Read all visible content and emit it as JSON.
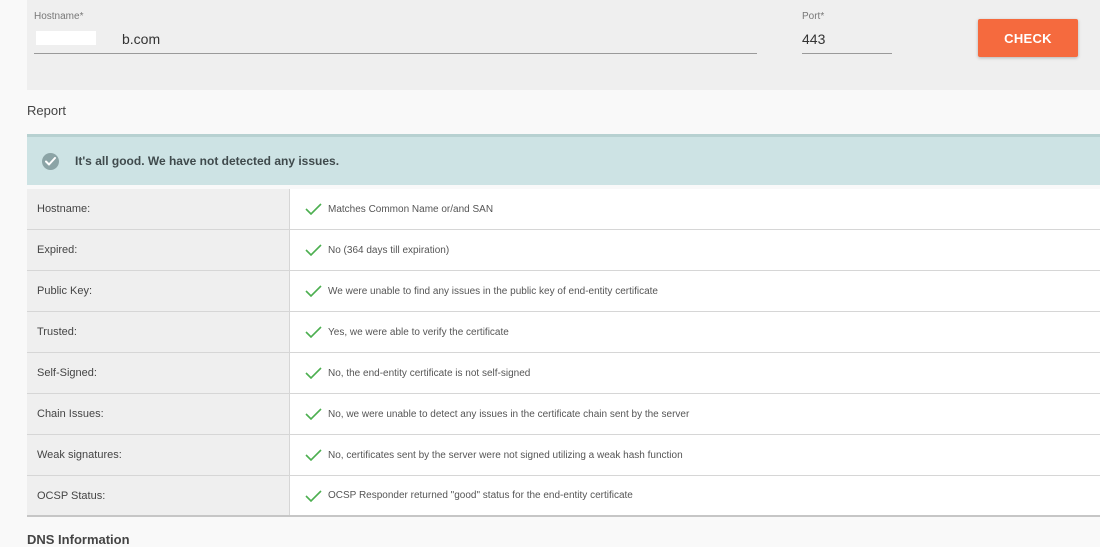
{
  "form": {
    "hostname_label": "Hostname*",
    "hostname_value": "b.com",
    "port_label": "Port*",
    "port_value": "443",
    "check_button": "CHECK"
  },
  "report": {
    "title": "Report",
    "status_message": "It's all good. We have not detected any issues.",
    "rows": [
      {
        "label": "Hostname:",
        "value": "Matches Common Name or/and SAN"
      },
      {
        "label": "Expired:",
        "value": "No (364 days till expiration)"
      },
      {
        "label": "Public Key:",
        "value": "We were unable to find any issues in the public key of end-entity certificate"
      },
      {
        "label": "Trusted:",
        "value": "Yes, we were able to verify the certificate"
      },
      {
        "label": "Self-Signed:",
        "value": "No, the end-entity certificate is not self-signed"
      },
      {
        "label": "Chain Issues:",
        "value": "No, we were unable to detect any issues in the certificate chain sent by the server"
      },
      {
        "label": "Weak signatures:",
        "value": "No, certificates sent by the server were not signed utilizing a weak hash function"
      },
      {
        "label": "OCSP Status:",
        "value": "OCSP Responder returned \"good\" status for the end-entity certificate"
      }
    ]
  },
  "dns": {
    "title": "DNS Information"
  },
  "colors": {
    "accent_button": "#f56a3e",
    "banner_bg": "#cde3e4",
    "check_green": "#4caf50"
  },
  "icons": {
    "banner": "check-circle-icon",
    "row": "check-icon"
  }
}
